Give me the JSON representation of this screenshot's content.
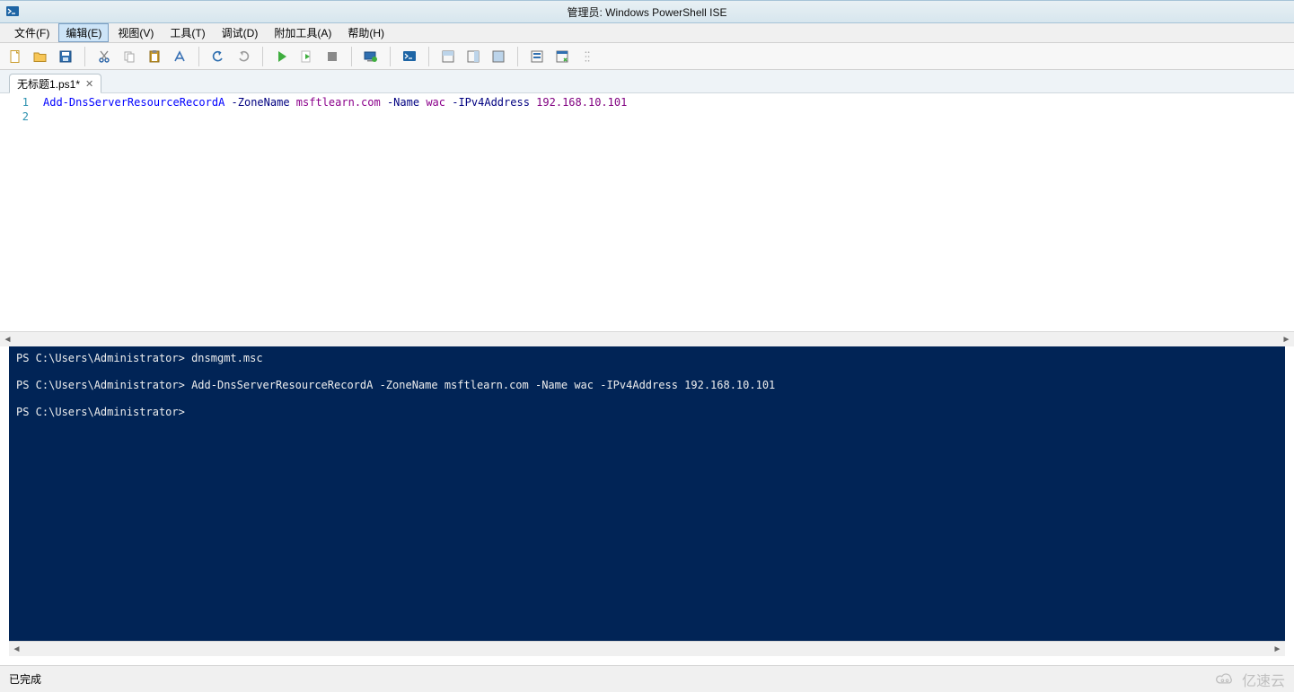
{
  "title": "管理员: Windows PowerShell ISE",
  "menu": {
    "file": "文件(F)",
    "edit": "编辑(E)",
    "view": "视图(V)",
    "tools": "工具(T)",
    "debug": "调试(D)",
    "addons": "附加工具(A)",
    "help": "帮助(H)"
  },
  "tabs": {
    "items": [
      {
        "label": "无标题1.ps1*"
      }
    ]
  },
  "editor": {
    "lines": [
      {
        "tokens": [
          {
            "t": "Add-DnsServerResourceRecordA",
            "cls": "tok-cmdlet"
          },
          {
            "t": " ",
            "cls": "tok-plain"
          },
          {
            "t": "-ZoneName",
            "cls": "tok-param"
          },
          {
            "t": " ",
            "cls": "tok-plain"
          },
          {
            "t": "msftlearn.com",
            "cls": "tok-string"
          },
          {
            "t": " ",
            "cls": "tok-plain"
          },
          {
            "t": "-Name",
            "cls": "tok-param"
          },
          {
            "t": " ",
            "cls": "tok-plain"
          },
          {
            "t": "wac",
            "cls": "tok-string"
          },
          {
            "t": " ",
            "cls": "tok-plain"
          },
          {
            "t": "-IPv4Address",
            "cls": "tok-param"
          },
          {
            "t": " ",
            "cls": "tok-plain"
          },
          {
            "t": "192.168.10.101",
            "cls": "tok-number"
          }
        ]
      },
      {
        "tokens": []
      }
    ]
  },
  "console": {
    "lines": [
      {
        "prompt": "PS C:\\Users\\Administrator>",
        "cmd": " dnsmgmt.msc"
      },
      {
        "prompt": "PS C:\\Users\\Administrator>",
        "cmd": " Add-DnsServerResourceRecordA -ZoneName msftlearn.com -Name wac -IPv4Address 192.168.10.101"
      },
      {
        "prompt": "PS C:\\Users\\Administrator>",
        "cmd": " "
      }
    ]
  },
  "status": {
    "text": "已完成"
  },
  "watermark": "亿速云"
}
